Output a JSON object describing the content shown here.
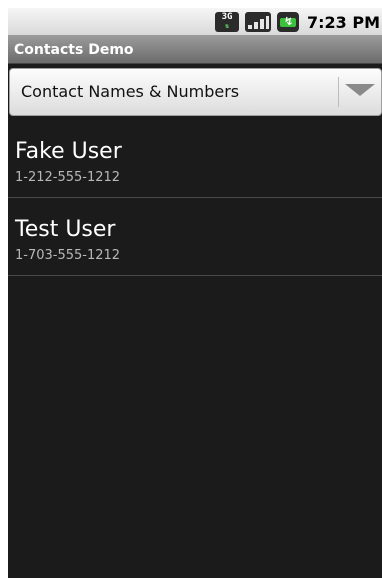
{
  "status_bar": {
    "network_label": "3G",
    "time": "7:23 PM",
    "icons": [
      "3g-data-icon",
      "signal-strength-icon",
      "battery-charging-icon"
    ]
  },
  "title_bar": {
    "title": "Contacts Demo"
  },
  "spinner": {
    "selected": "Contact Names & Numbers"
  },
  "contacts": [
    {
      "name": "Fake User",
      "number": "1-212-555-1212"
    },
    {
      "name": "Test User",
      "number": "1-703-555-1212"
    }
  ],
  "colors": {
    "list_background": "#1b1b1b",
    "title_bar": "#7f7f7f",
    "battery_green": "#3cc13c"
  }
}
